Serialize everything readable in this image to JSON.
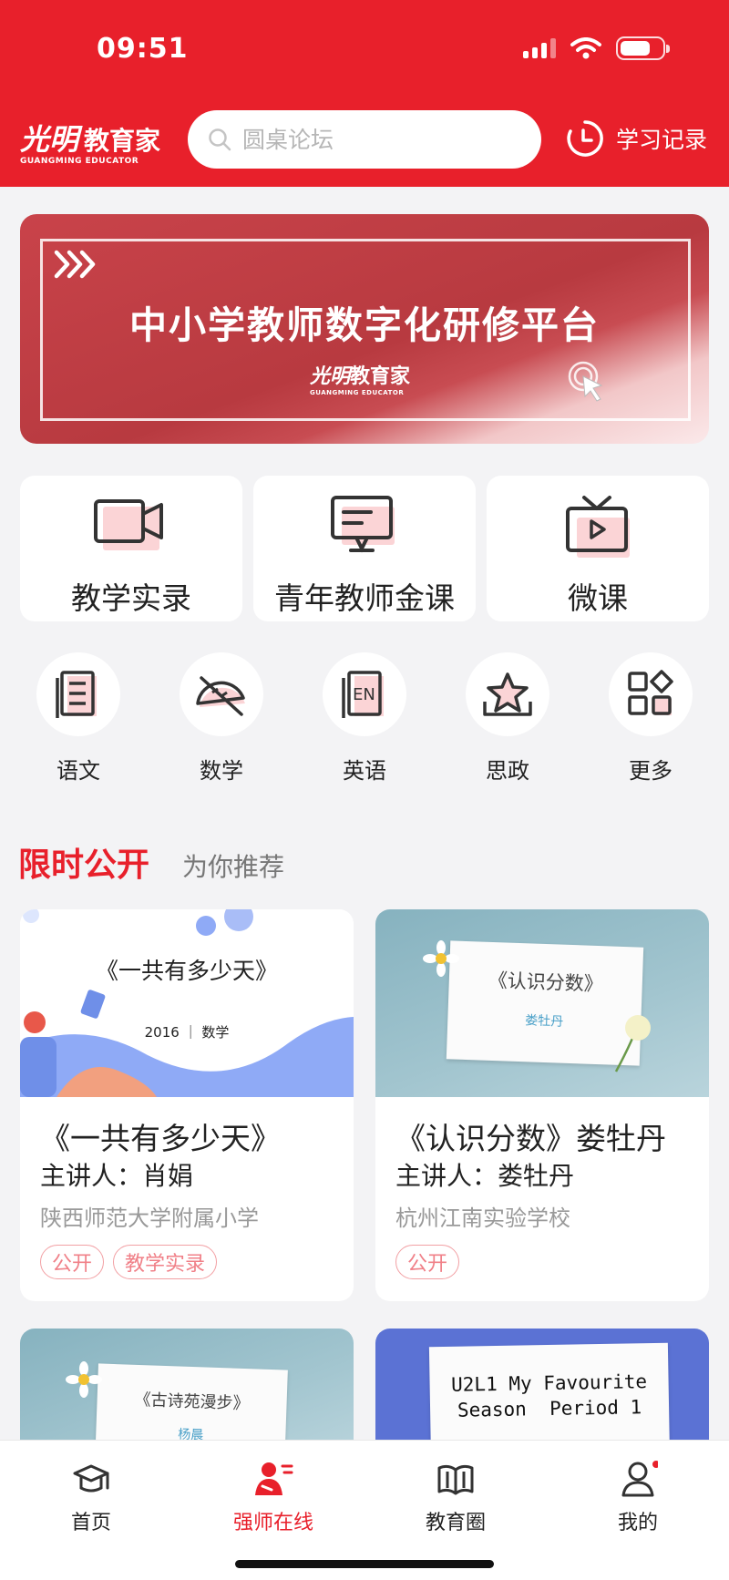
{
  "status": {
    "time": "09:51"
  },
  "header": {
    "logo_calligraphy": "光明",
    "logo_name": "教育家",
    "logo_en": "GUANGMING EDUCATOR",
    "search_placeholder": "圆桌论坛",
    "history_label": "学习记录",
    "brand_color": "#e8202b"
  },
  "banner": {
    "title": "中小学教师数字化研修平台",
    "logo_calligraphy": "光明",
    "logo_name": "教育家",
    "logo_en": "GUANGMING EDUCATOR"
  },
  "categories": [
    {
      "label": "教学实录",
      "icon": "video-camera-icon"
    },
    {
      "label": "青年教师金课",
      "icon": "monitor-icon"
    },
    {
      "label": "微课",
      "icon": "tv-play-icon"
    }
  ],
  "subjects": [
    {
      "label": "语文",
      "icon": "document-icon"
    },
    {
      "label": "数学",
      "icon": "protractor-icon"
    },
    {
      "label": "英语",
      "icon": "en-book-icon"
    },
    {
      "label": "思政",
      "icon": "star-icon"
    },
    {
      "label": "更多",
      "icon": "grid-more-icon"
    }
  ],
  "section_tabs": {
    "active": "限时公开",
    "other": "为你推荐"
  },
  "courses": [
    {
      "thumb_title": "《一共有多少天》",
      "thumb_sub": "2016 ｜ 数学",
      "title": "《一共有多少天》",
      "speaker": "主讲人：肖娟",
      "school": "陕西师范大学附属小学",
      "tags": [
        "公开",
        "教学实录"
      ]
    },
    {
      "thumb_title": "《认识分数》",
      "thumb_sub": "娄牡丹",
      "title": "《认识分数》娄牡丹",
      "speaker": "主讲人：娄牡丹",
      "school": "杭州江南实验学校",
      "tags": [
        "公开"
      ]
    },
    {
      "thumb_title": "《古诗苑漫步》",
      "thumb_sub": "杨晨"
    },
    {
      "thumb_title": "U2L1 My Favourite",
      "thumb_sub": "Season  Period 1"
    }
  ],
  "tabbar": [
    {
      "label": "首页",
      "icon": "graduation-cap-icon"
    },
    {
      "label": "强师在线",
      "icon": "teacher-icon"
    },
    {
      "label": "教育圈",
      "icon": "book-open-icon"
    },
    {
      "label": "我的",
      "icon": "user-icon"
    }
  ]
}
